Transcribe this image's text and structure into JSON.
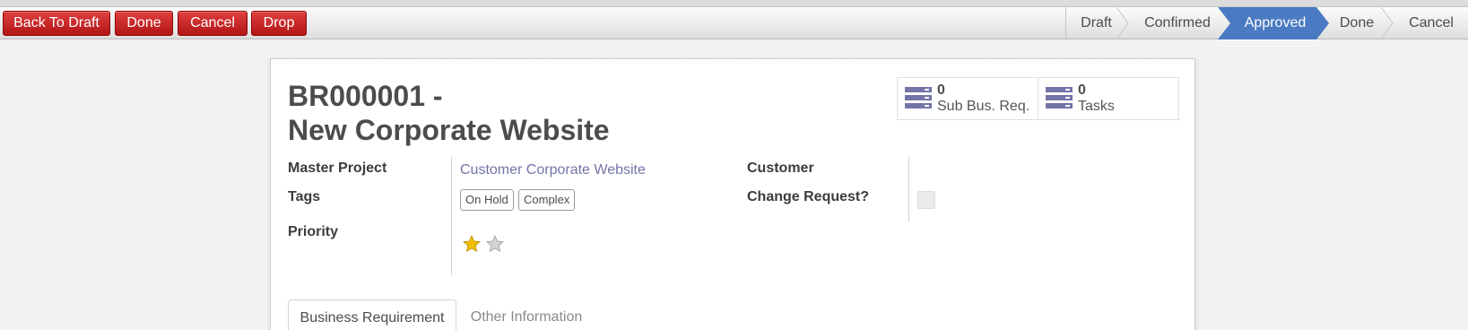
{
  "actions": {
    "back_to_draft": "Back To Draft",
    "done": "Done",
    "cancel": "Cancel",
    "drop": "Drop"
  },
  "statusbar": {
    "stages": [
      "Draft",
      "Confirmed",
      "Approved",
      "Done",
      "Cancel"
    ],
    "active_stage": "Approved",
    "active_color": "#4a7bc2"
  },
  "record": {
    "title_line1": "BR000001 -",
    "title_line2": "New Corporate Website"
  },
  "smart_buttons": [
    {
      "count": "0",
      "label": "Sub Bus. Req.",
      "icon": "server-list-icon"
    },
    {
      "count": "0",
      "label": "Tasks",
      "icon": "server-list-icon"
    }
  ],
  "fields": {
    "master_project": {
      "label": "Master Project",
      "value": "Customer Corporate Website"
    },
    "tags": {
      "label": "Tags",
      "values": [
        "On Hold",
        "Complex"
      ]
    },
    "priority": {
      "label": "Priority",
      "value": 1,
      "max": 2
    },
    "customer": {
      "label": "Customer",
      "value": ""
    },
    "change_request": {
      "label": "Change Request?",
      "checked": false
    }
  },
  "tabs": [
    {
      "label": "Business Requirement",
      "active": true
    },
    {
      "label": "Other Information",
      "active": false
    }
  ],
  "colors": {
    "button_red": "#c62020",
    "link": "#7274a8",
    "star_filled": "#f0c000",
    "star_empty": "#c4c4c4",
    "icon_color": "#7274a8"
  }
}
